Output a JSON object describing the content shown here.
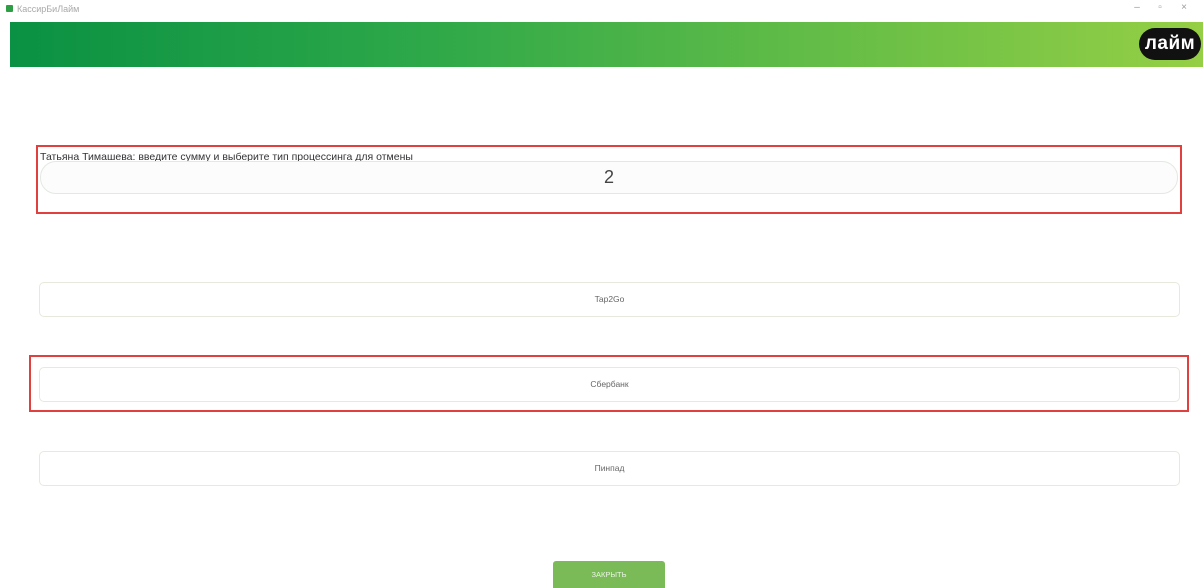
{
  "window": {
    "title": "КассирБиЛайм",
    "minimize": "–",
    "maximize": "▫",
    "close": "×"
  },
  "header": {
    "logo_text": "лайм",
    "accent_colors": [
      "#0a9143",
      "#95cf45"
    ]
  },
  "form": {
    "prompt": "Татьяна Тимашева: введите сумму и выберите тип процессинга для отмены",
    "amount_value": "2",
    "highlight_color": "#e0403e"
  },
  "processing": {
    "options": [
      {
        "label": "Tap2Go"
      },
      {
        "label": "Сбербанк"
      },
      {
        "label": "Пинпад"
      }
    ]
  },
  "footer": {
    "close_label": "ЗАКРЫТЬ",
    "close_color": "#7abb58"
  }
}
